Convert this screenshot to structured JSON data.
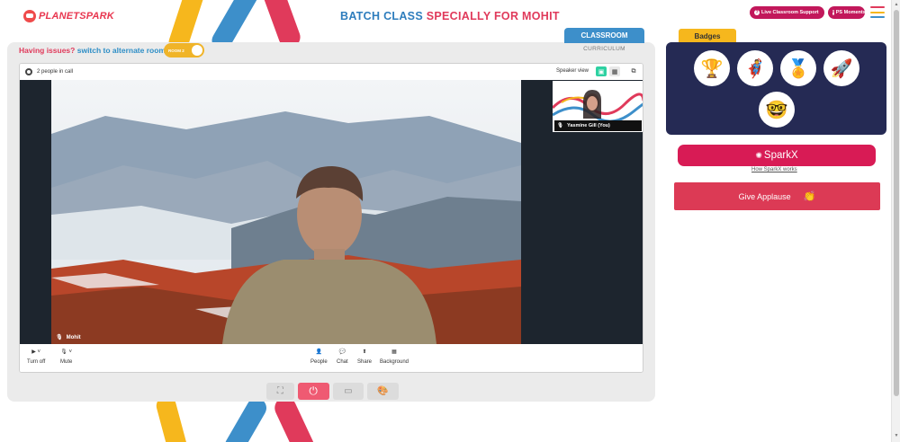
{
  "brand": {
    "logo_text": "PLANETSPARK"
  },
  "header": {
    "title_part1": "BATCH CLASS",
    "title_part2": "SPECIALLY FOR MOHIT",
    "live_support_label": "Live Classroom Support",
    "ps_moments_label": "PS Moments"
  },
  "room": {
    "issues_text": "Having issues?",
    "switch_text": "switch to alternate room",
    "toggle_label": "ROOM 2"
  },
  "tabs": {
    "classroom": "CLASSROOM",
    "curriculum": "CURRICULUM"
  },
  "call": {
    "people_count": "2 people in call",
    "view_label": "Speaker view",
    "main_participant": "Mohit",
    "self_participant": "Yasmine Gill (You)"
  },
  "controls": {
    "camera": "Turn off",
    "mic": "Mute",
    "people": "People",
    "chat": "Chat",
    "share": "Share",
    "background": "Background"
  },
  "right_panel": {
    "badges_title": "Badges",
    "sparkx_label": "SparkX",
    "sparkx_link": "How SparkX works",
    "applause_label": "Give Applause"
  },
  "colors": {
    "brand_red": "#e03a5b",
    "brand_blue": "#2e7dbd",
    "badge_panel": "#252a54",
    "sparkx": "#d81b55",
    "applause": "#dc3a55",
    "tab_yellow": "#f6b71d",
    "tab_blue": "#3d8fca"
  },
  "icons": [
    "settings-icon",
    "mic-icon",
    "camera-icon",
    "people-icon",
    "chat-icon",
    "share-icon",
    "background-icon",
    "fullscreen-icon",
    "power-icon",
    "screen-icon",
    "palette-icon",
    "clap-icon"
  ]
}
